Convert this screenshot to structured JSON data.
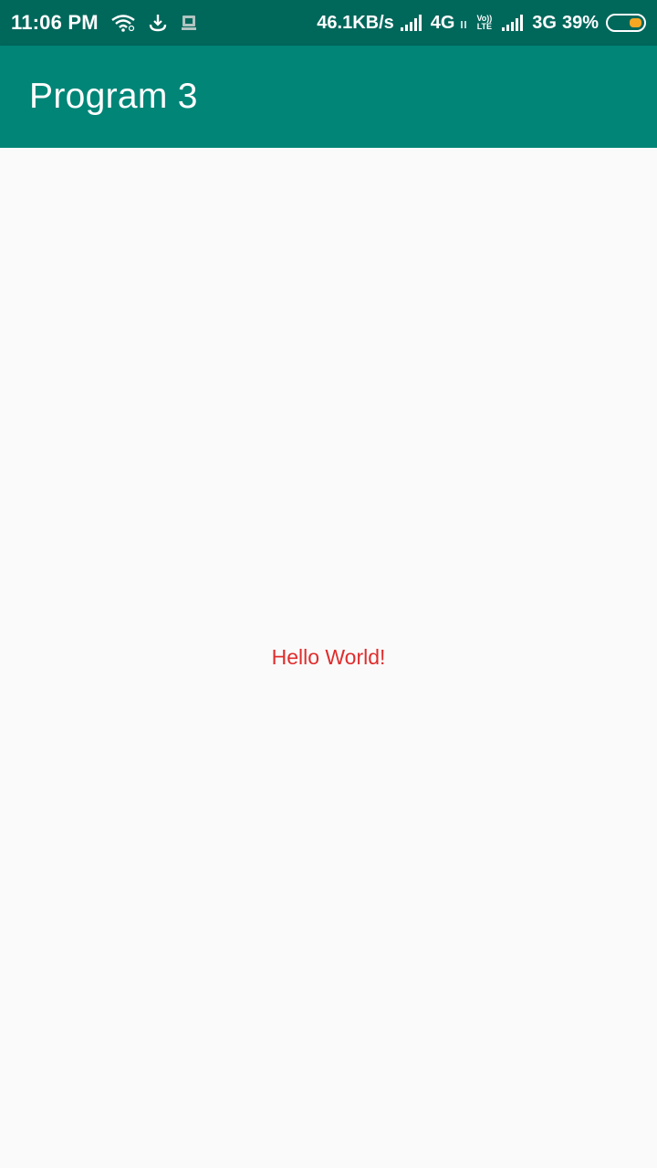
{
  "status_bar": {
    "time": "11:06 PM",
    "network_speed": "46.1KB/s",
    "sim1_type": "4G",
    "volte_top": "Vo))",
    "volte_bottom": "LTE",
    "sim2_type": "3G",
    "battery_percent": "39%",
    "battery_level": 0.39,
    "battery_color": "#f5a623",
    "icons": [
      "wifi-icon",
      "download-icon",
      "notification-app-icon",
      "signal-icon",
      "signal-icon",
      "battery-icon"
    ]
  },
  "app_bar": {
    "title": "Program 3",
    "color": "#008577"
  },
  "main": {
    "message": "Hello World!",
    "message_color": "#e02d2d"
  }
}
